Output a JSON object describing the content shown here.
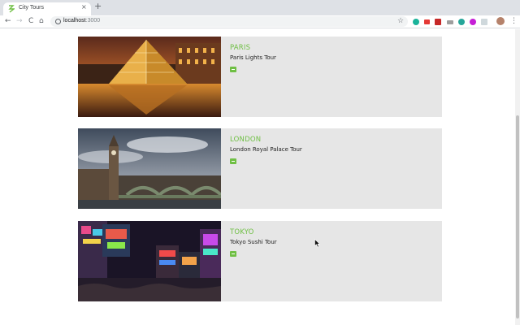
{
  "browser": {
    "tab_title": "City Tours",
    "tab_close": "×",
    "new_tab": "+",
    "url_host": "localhost",
    "url_port": ":3000",
    "back": "←",
    "forward": "→",
    "reload": "C",
    "home": "⌂",
    "star": "☆",
    "menu": "⋮"
  },
  "tours": [
    {
      "city": "PARIS",
      "tour": "Paris Lights Tour"
    },
    {
      "city": "LONDON",
      "tour": "London Royal Palace Tour"
    },
    {
      "city": "TOKYO",
      "tour": "Tokyo Sushi Tour"
    }
  ],
  "colors": {
    "accent": "#6fbf44",
    "card_bg": "#e6e6e6"
  }
}
